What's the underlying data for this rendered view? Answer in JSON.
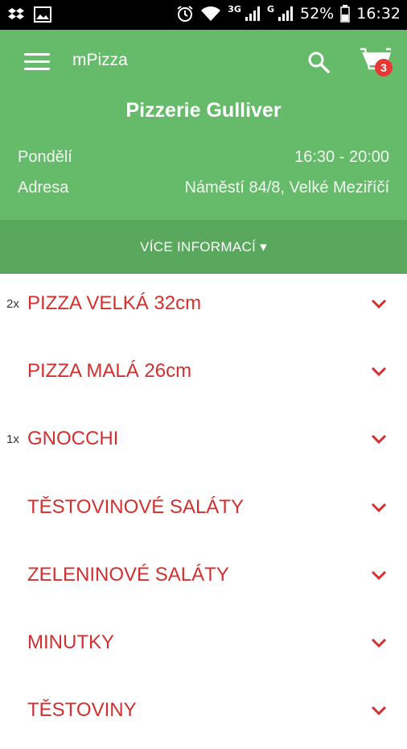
{
  "status_bar": {
    "battery": "52%",
    "time": "16:32",
    "network1": "3G",
    "network2": "G"
  },
  "app_bar": {
    "title": "mPizza",
    "cart_count": "3",
    "icons": [
      "menu-icon",
      "search-icon",
      "cart-icon"
    ]
  },
  "restaurant": {
    "name": "Pizzerie Gulliver",
    "day_label": "Pondělí",
    "hours": "16:30 - 20:00",
    "address_label": "Adresa",
    "address": "Náměstí 84/8, Velké Meziříčí",
    "more_info": "VÍCE INFORMACÍ ▾"
  },
  "menu": {
    "categories": [
      {
        "label": "PIZZA VELKÁ 32cm",
        "qty": "2x"
      },
      {
        "label": "PIZZA MALÁ 26cm",
        "qty": ""
      },
      {
        "label": "GNOCCHI",
        "qty": "1x"
      },
      {
        "label": "TĚSTOVINOVÉ SALÁTY",
        "qty": ""
      },
      {
        "label": "ZELENINOVÉ SALÁTY",
        "qty": ""
      },
      {
        "label": "MINUTKY",
        "qty": ""
      },
      {
        "label": "TĚSTOVINY",
        "qty": ""
      }
    ]
  },
  "colors": {
    "app_bar": "#66bb6a",
    "more_bar": "#5aa85e",
    "category_text": "#d32f2f",
    "badge": "#e53935"
  }
}
